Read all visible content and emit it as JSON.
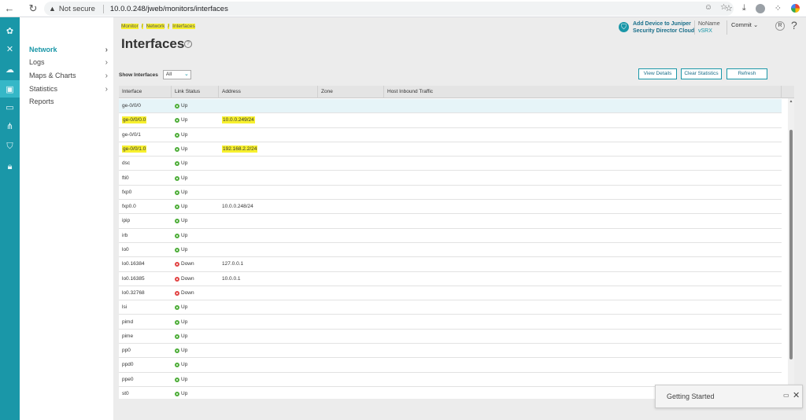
{
  "browser": {
    "security_label": "Not secure",
    "url": "10.0.0.248/jweb/monitors/interfaces"
  },
  "sidebar": {
    "items": [
      {
        "label": "Network",
        "active": true,
        "chevron": true
      },
      {
        "label": "Logs",
        "active": false,
        "chevron": true
      },
      {
        "label": "Maps & Charts",
        "active": false,
        "chevron": true
      },
      {
        "label": "Statistics",
        "active": false,
        "chevron": true
      },
      {
        "label": "Reports",
        "active": false,
        "chevron": false
      }
    ]
  },
  "breadcrumb": [
    "Monitor",
    "Network",
    "Interfaces"
  ],
  "page_title": "Interfaces",
  "header": {
    "add_device_line1": "Add Device to Juniper",
    "add_device_line2": "Security Director Cloud",
    "device_name": "NoName",
    "device_model": "vSRX",
    "commit_label": "Commit",
    "user_initial": "R",
    "help": "?"
  },
  "filter": {
    "label": "Show Interfaces",
    "value": "All"
  },
  "buttons": {
    "view_details": "View Details",
    "clear_statistics": "Clear Statistics",
    "refresh": "Refresh"
  },
  "table": {
    "columns": [
      "Interface",
      "Link Status",
      "Address",
      "Zone",
      "Host Inbound Traffic"
    ],
    "rows": [
      {
        "interface": "ge-0/0/0",
        "status": "Up",
        "address": "",
        "zone": "",
        "host": "",
        "selected": true,
        "highlight": false
      },
      {
        "interface": "ge-0/0/0.0",
        "status": "Up",
        "address": "10.0.0.249/24",
        "zone": "",
        "host": "",
        "selected": false,
        "highlight": true
      },
      {
        "interface": "ge-0/0/1",
        "status": "Up",
        "address": "",
        "zone": "",
        "host": "",
        "selected": false,
        "highlight": false
      },
      {
        "interface": "ge-0/0/1.0",
        "status": "Up",
        "address": "192.168.2.2/24",
        "zone": "",
        "host": "",
        "selected": false,
        "highlight": true
      },
      {
        "interface": "dsc",
        "status": "Up",
        "address": "",
        "zone": "",
        "host": "",
        "selected": false,
        "highlight": false
      },
      {
        "interface": "fti0",
        "status": "Up",
        "address": "",
        "zone": "",
        "host": "",
        "selected": false,
        "highlight": false
      },
      {
        "interface": "fxp0",
        "status": "Up",
        "address": "",
        "zone": "",
        "host": "",
        "selected": false,
        "highlight": false
      },
      {
        "interface": "fxp0.0",
        "status": "Up",
        "address": "10.0.0.248/24",
        "zone": "",
        "host": "",
        "selected": false,
        "highlight": false
      },
      {
        "interface": "ipip",
        "status": "Up",
        "address": "",
        "zone": "",
        "host": "",
        "selected": false,
        "highlight": false
      },
      {
        "interface": "irb",
        "status": "Up",
        "address": "",
        "zone": "",
        "host": "",
        "selected": false,
        "highlight": false
      },
      {
        "interface": "lo0",
        "status": "Up",
        "address": "",
        "zone": "",
        "host": "",
        "selected": false,
        "highlight": false
      },
      {
        "interface": "lo0.16384",
        "status": "Down",
        "address": "127.0.0.1",
        "zone": "",
        "host": "",
        "selected": false,
        "highlight": false
      },
      {
        "interface": "lo0.16385",
        "status": "Down",
        "address": "10.0.0.1",
        "zone": "",
        "host": "",
        "selected": false,
        "highlight": false
      },
      {
        "interface": "lo0.32768",
        "status": "Down",
        "address": "",
        "zone": "",
        "host": "",
        "selected": false,
        "highlight": false
      },
      {
        "interface": "lsi",
        "status": "Up",
        "address": "",
        "zone": "",
        "host": "",
        "selected": false,
        "highlight": false
      },
      {
        "interface": "pimd",
        "status": "Up",
        "address": "",
        "zone": "",
        "host": "",
        "selected": false,
        "highlight": false
      },
      {
        "interface": "pime",
        "status": "Up",
        "address": "",
        "zone": "",
        "host": "",
        "selected": false,
        "highlight": false
      },
      {
        "interface": "pp0",
        "status": "Up",
        "address": "",
        "zone": "",
        "host": "",
        "selected": false,
        "highlight": false
      },
      {
        "interface": "ppd0",
        "status": "Up",
        "address": "",
        "zone": "",
        "host": "",
        "selected": false,
        "highlight": false
      },
      {
        "interface": "ppe0",
        "status": "Up",
        "address": "",
        "zone": "",
        "host": "",
        "selected": false,
        "highlight": false
      },
      {
        "interface": "st0",
        "status": "Up",
        "address": "",
        "zone": "",
        "host": "",
        "selected": false,
        "highlight": false
      }
    ]
  },
  "getting_started": {
    "label": "Getting Started"
  },
  "colors": {
    "accent": "#1a97a8",
    "highlight": "#f7f02e",
    "status_up": "#4fae3a",
    "status_down": "#e24545"
  }
}
